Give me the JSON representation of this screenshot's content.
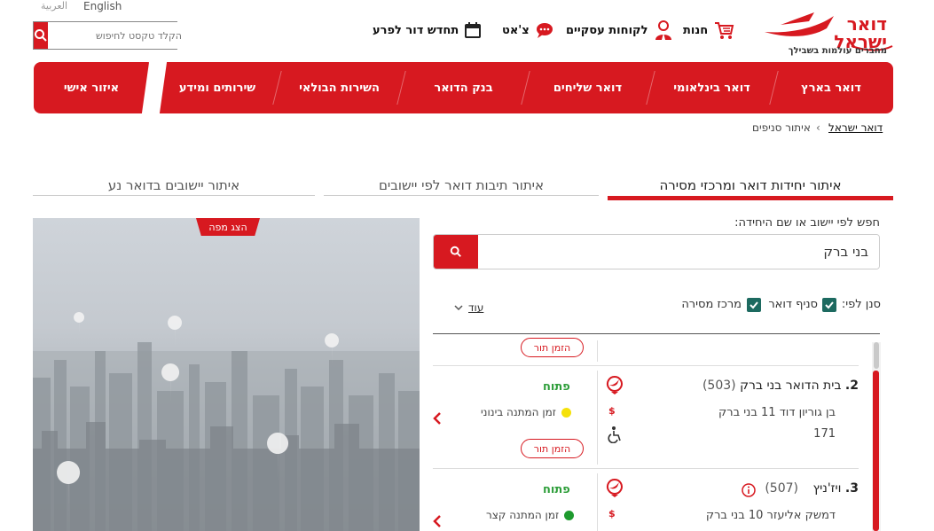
{
  "header": {
    "lang_english": "English",
    "lang_arabic": "العربية",
    "search_placeholder": "הקלד טקסט לחיפוש",
    "links": {
      "store": "חנות",
      "business": "לקוחות עסקיים",
      "chat": "צ'אט",
      "appointment": "תחדש דור לפרע"
    },
    "logo_tagline": "מחברים עולמות בשבילך"
  },
  "nav": {
    "items": [
      "דואר בארץ",
      "דואר בינלאומי",
      "דואר שליחים",
      "בנק הדואר",
      "השירות הבולאי",
      "שירותים ומידע"
    ],
    "personal": "איזור אישי"
  },
  "breadcrumb": {
    "home": "דואר ישראל",
    "separator": "›",
    "current": "איתור סניפים"
  },
  "tabs": [
    "איתור יחידות דואר ומרכזי מסירה",
    "איתור תיבות דואר לפי יישובים",
    "איתור יישובים בדואר נע"
  ],
  "map": {
    "show_map": "הצג מפה"
  },
  "search": {
    "label": "חפש לפי יישוב או שם היחידה:",
    "value": "בני ברק"
  },
  "filter": {
    "label": "סנן לפי:",
    "opt_branch": "סניף דואר",
    "opt_center": "מרכז מסירה",
    "more": "עוד"
  },
  "results": [
    {
      "book_label": "הזמן תור"
    },
    {
      "number": "2.",
      "name": "בית הדואר בני ברק",
      "code": "(503)",
      "address_line1": "בן גוריון דוד 11 בני ברק",
      "address_line2": "171",
      "status": "פתוח",
      "wait": "זמן המתנה בינוני",
      "wait_color": "#f5e10a",
      "book_label": "הזמן תור"
    },
    {
      "number": "3.",
      "name": "ויז'ניץ",
      "code": "(507)",
      "address_line1": "דמשק אליעזר 10 בני ברק",
      "status": "פתוח",
      "wait": "זמן המתנה קצר",
      "wait_color": "#1e9a2e"
    }
  ],
  "colors": {
    "brand_red": "#d71920",
    "open_green": "#2e9e3a",
    "checkbox_teal": "#1d6a60"
  }
}
